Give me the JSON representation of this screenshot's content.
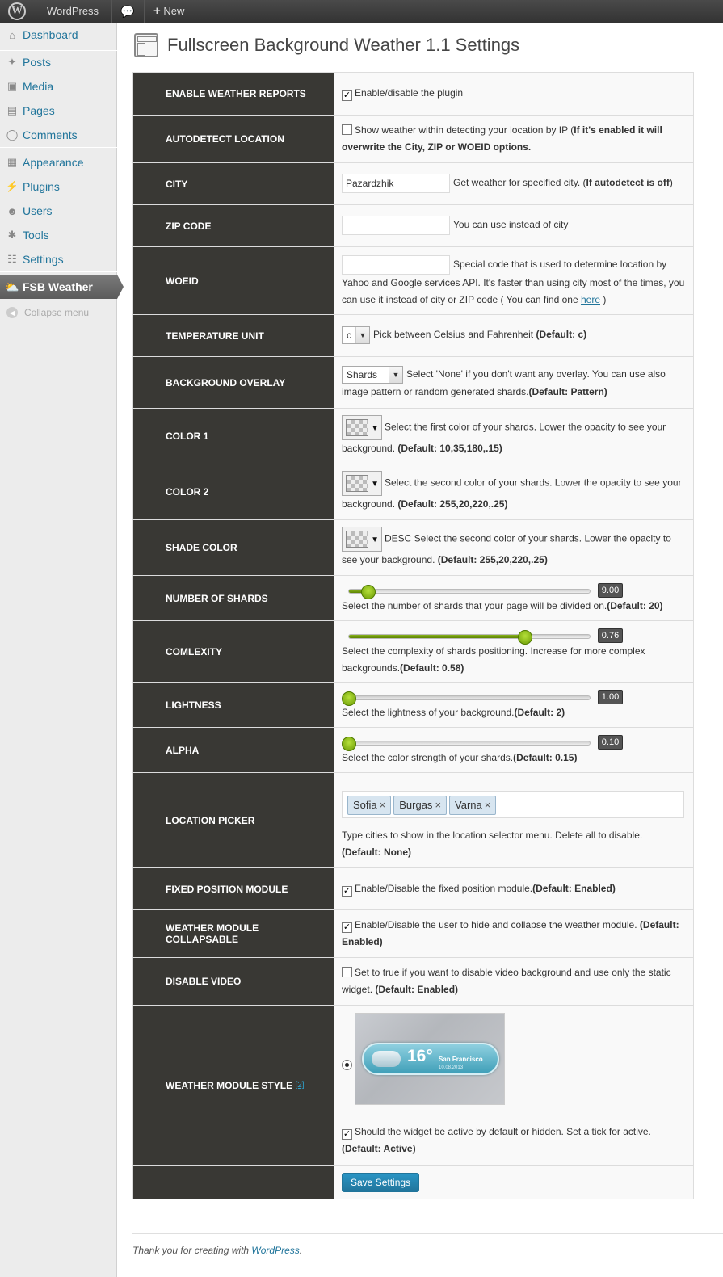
{
  "adminbar": {
    "logo": "W",
    "site_name": "WordPress",
    "comments_icon": "speech-bubble-icon",
    "new_label": "New"
  },
  "sidebar": {
    "items": [
      {
        "label": "Dashboard",
        "icon": "house-icon"
      },
      {
        "label": "Posts",
        "icon": "pushpin-icon"
      },
      {
        "label": "Media",
        "icon": "media-icon"
      },
      {
        "label": "Pages",
        "icon": "pages-icon"
      },
      {
        "label": "Comments",
        "icon": "comment-icon"
      },
      {
        "label": "Appearance",
        "icon": "appearance-icon"
      },
      {
        "label": "Plugins",
        "icon": "plug-icon"
      },
      {
        "label": "Users",
        "icon": "users-icon"
      },
      {
        "label": "Tools",
        "icon": "tools-icon"
      },
      {
        "label": "Settings",
        "icon": "settings-icon"
      }
    ],
    "active": {
      "label": "FSB Weather",
      "icon": "weather-icon"
    },
    "collapse": "Collapse menu"
  },
  "page": {
    "title": "Fullscreen Background Weather 1.1 Settings"
  },
  "settings": {
    "enable": {
      "label": "Enable weather reports",
      "text": "Enable/disable the plugin",
      "checked": true
    },
    "autodetect": {
      "label": "Autodetect location",
      "text": "Show weather within detecting your location by IP (",
      "bold": "If it's enabled it will overwrite the City, ZIP or WOEID options.",
      "checked": false
    },
    "city": {
      "label": "City",
      "value": "Pazardzhik",
      "text": "Get weather for specified city. (",
      "bold": "If autodetect is off",
      "close": ")"
    },
    "zip": {
      "label": "ZIP code",
      "value": "",
      "text": "You can use instead of city"
    },
    "woeid": {
      "label": "WOEID",
      "value": "",
      "text": "Special code that is used to determine location by Yahoo and Google services API. It's faster than using city most of the times, you can use it instead of city or ZIP code ( You can find one ",
      "link": "here",
      "close": " )"
    },
    "temperature_unit": {
      "label": "Temperature unit",
      "selected": "c",
      "text": "Pick between Celsius and Fahrenheit ",
      "bold": "(Default: c)"
    },
    "background_overlay": {
      "label": "Background overlay",
      "selected": "Shards",
      "text": "Select 'None' if you don't want any overlay. You can use also image pattern or random generated shards.",
      "bold": "(Default: Pattern)"
    },
    "color1": {
      "label": "Color 1",
      "text": "Select the first color of your shards. Lower the opacity to see your background. ",
      "bold": "(Default: 10,35,180,.15)"
    },
    "color2": {
      "label": "Color 2",
      "text": "Select the second color of your shards. Lower the opacity to see your background. ",
      "bold": "(Default: 255,20,220,.25)"
    },
    "shade_color": {
      "label": "Shade color",
      "text": "DESC Select the second color of your shards. Lower the opacity to see your background. ",
      "bold": "(Default: 255,20,220,.25)"
    },
    "number_of_shards": {
      "label": "Number of shards",
      "value": "9.00",
      "fraction": 0.08,
      "text": "Select the number of shards that your page will be divided on.",
      "bold": "(Default: 20)"
    },
    "complexity": {
      "label": "Comlexity",
      "value": "0.76",
      "fraction": 0.73,
      "text": "Select the complexity of shards positioning. Increase for more complex backgrounds.",
      "bold": "(Default: 0.58)"
    },
    "lightness": {
      "label": "Lightness",
      "value": "1.00",
      "fraction": 0.0,
      "text": "Select the lightness of your background.",
      "bold": "(Default: 2)"
    },
    "alpha": {
      "label": "Alpha",
      "value": "0.10",
      "fraction": 0.0,
      "text": "Select the color strength of your shards.",
      "bold": "(Default: 0.15)"
    },
    "location_picker": {
      "label": "Location picker",
      "tags": [
        "Sofia",
        "Burgas",
        "Varna"
      ],
      "text": "Type cities to show in the location selector menu. Delete all to disable.",
      "bold": "(Default: None)"
    },
    "fixed_position": {
      "label": "Fixed position module",
      "text": "Enable/Disable the fixed position module.",
      "bold": "(Default: Enabled)",
      "checked": true
    },
    "collapsable": {
      "label": "Weather module collapsable",
      "text": "Enable/Disable the user to hide and collapse the weather module. ",
      "bold": "(Default: Enabled)",
      "checked": true
    },
    "disable_video": {
      "label": "Disable video",
      "text": "Set to true if you want to disable video background and use only the static widget. ",
      "bold": "(Default: Enabled)",
      "checked": false
    },
    "module_style": {
      "label": "Weather module style",
      "link": "[2]",
      "preview_temp": "16°",
      "preview_city": "San Francisco",
      "preview_date": "10.08.2013",
      "text": "Should the widget be active by default or hidden. Set a tick for active.",
      "bold": "(Default: Active)",
      "checked": true
    },
    "save_label": "Save Settings"
  },
  "footer": {
    "text": "Thank you for creating with ",
    "link": "WordPress",
    "dot": "."
  }
}
